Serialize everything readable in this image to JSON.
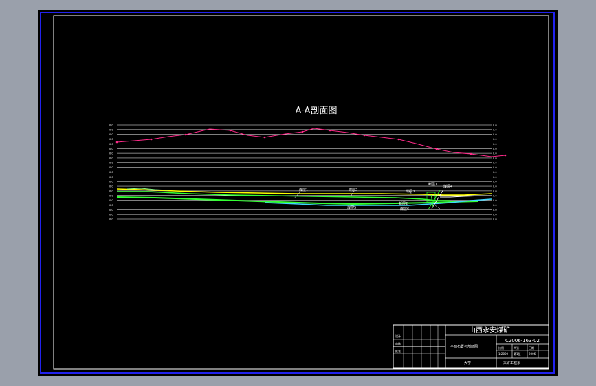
{
  "drawing": {
    "title": "A-A剖面图",
    "seam_labels": [
      "煤层1",
      "煤层2",
      "煤层3",
      "断层1",
      "煤层4",
      "煤层5",
      "断层2",
      "煤层6"
    ],
    "axis_tick_label": "0.0"
  },
  "title_block": {
    "company": "山西永安煤矿",
    "drawing_number": "C2006-163-02",
    "drawing_name": "平面布置与剖面图",
    "designer": "设计",
    "checker": "审核",
    "approver": "批准",
    "scale_label": "比例",
    "scale_value": "1:2000",
    "sheet_label": "共张",
    "sheet_value": "第1张",
    "date_label": "日期",
    "date_value": "2006",
    "material_label": "大学",
    "project_label": "采矿工程系"
  },
  "colors": {
    "background": "#000000",
    "frame": "#ffffff",
    "outer_frame": "#2222ee",
    "grid": "#ffffff",
    "surface_line": "#ff2b8a",
    "seam_yellow": "#ffff00",
    "seam_green": "#33ff33",
    "seam_cyan": "#3fd7ff",
    "seam_light_green": "#8aff8a"
  }
}
